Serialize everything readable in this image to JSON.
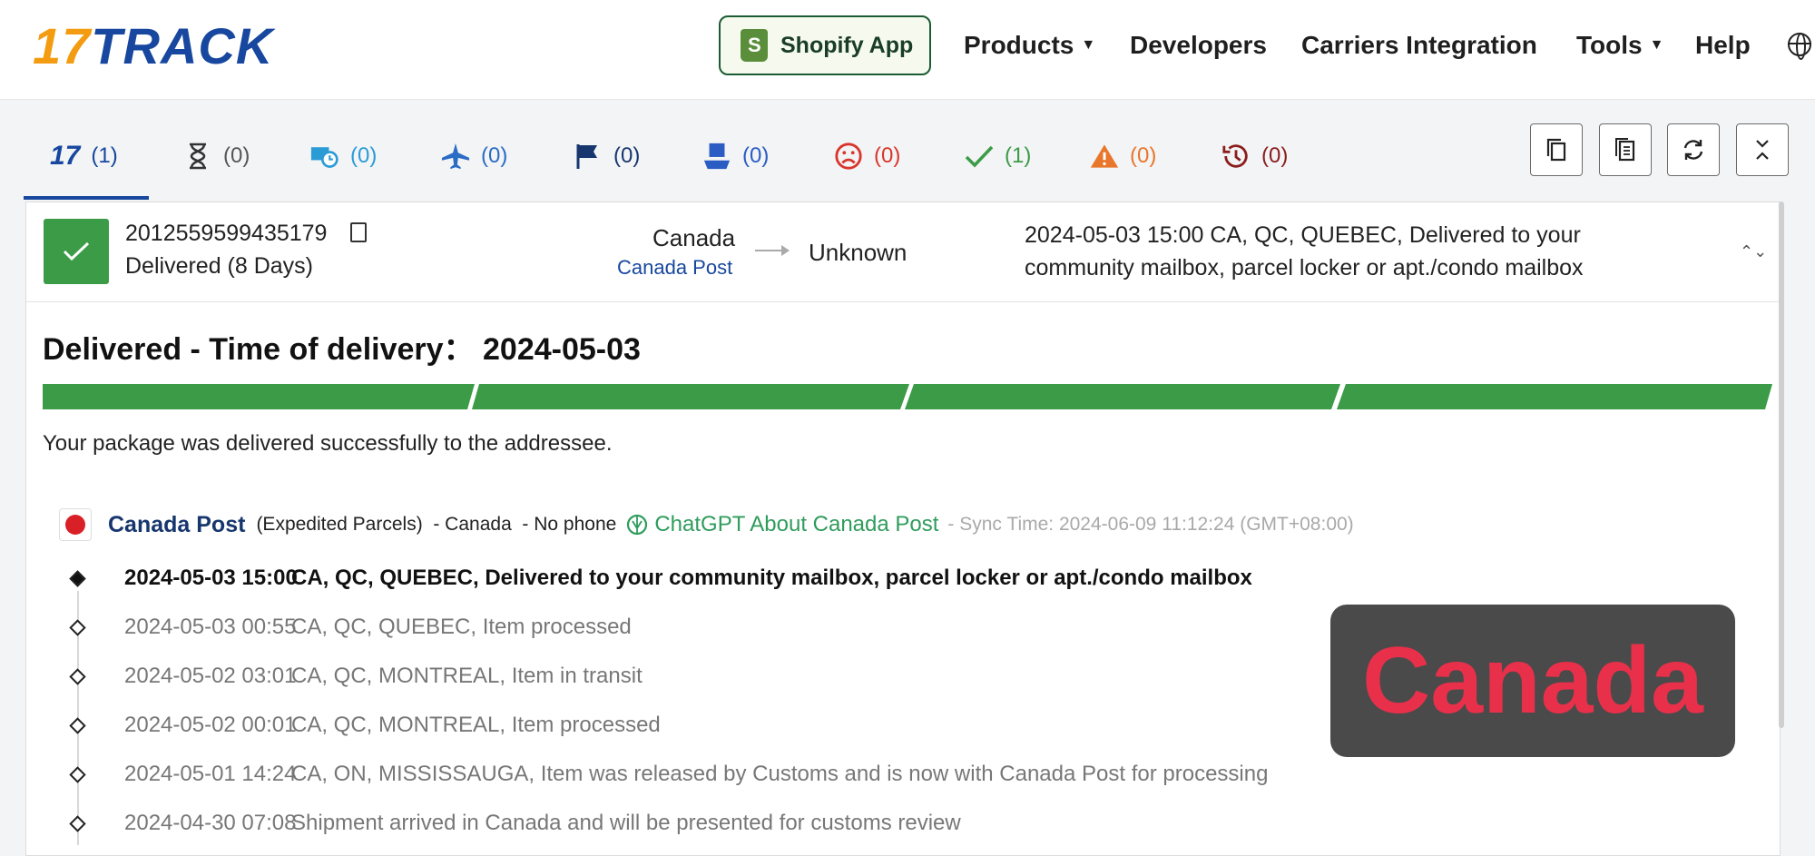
{
  "header": {
    "logo_17": "17",
    "logo_track": "TRACK",
    "shopify_label": "Shopify App",
    "nav": [
      {
        "label": "Products",
        "caret": true
      },
      {
        "label": "Developers",
        "caret": false
      },
      {
        "label": "Carriers Integration",
        "caret": false
      },
      {
        "label": "Tools",
        "caret": true
      },
      {
        "label": "Help",
        "caret": false
      }
    ]
  },
  "tabs": [
    {
      "icon": "17-logo-icon",
      "count": "(1)",
      "color": "#17479e"
    },
    {
      "icon": "hourglass-icon",
      "count": "(0)",
      "color": "#555555"
    },
    {
      "icon": "truck-clock-icon",
      "count": "(0)",
      "color": "#2b9bd6"
    },
    {
      "icon": "airplane-icon",
      "count": "(0)",
      "color": "#2b6cc4"
    },
    {
      "icon": "flag-icon",
      "count": "(0)",
      "color": "#17366e"
    },
    {
      "icon": "pickup-icon",
      "count": "(0)",
      "color": "#2b5cc4"
    },
    {
      "icon": "sad-face-icon",
      "count": "(0)",
      "color": "#d9362b"
    },
    {
      "icon": "check-icon",
      "count": "(1)",
      "color": "#3b9b46"
    },
    {
      "icon": "warning-icon",
      "count": "(0)",
      "color": "#e8762b"
    },
    {
      "icon": "history-icon",
      "count": "(0)",
      "color": "#8b1c1c"
    }
  ],
  "summary": {
    "tracking_number": "2012559599435179",
    "status": "Delivered (8 Days)",
    "origin_country": "Canada",
    "origin_carrier": "Canada Post",
    "destination": "Unknown",
    "latest_event": "2024-05-03 15:00  CA, QC, QUEBEC, Delivered to your community mailbox, parcel locker or apt./condo mailbox"
  },
  "delivery": {
    "title": "Delivered - Time of delivery：  2024-05-03",
    "progress_steps_completed": 4,
    "progress_steps_total": 4,
    "message": "Your package was delivered successfully to the addressee."
  },
  "carrier": {
    "name": "Canada Post",
    "service": "(Expedited Parcels)",
    "country": "- Canada",
    "phone": "- No phone",
    "chatgpt_label": "ChatGPT About Canada Post",
    "sync_time": "- Sync Time: 2024-06-09 11:12:24 (GMT+08:00)"
  },
  "events": [
    {
      "time": "2024-05-03 15:00",
      "desc": "CA, QC, QUEBEC, Delivered to your community mailbox, parcel locker or apt./condo mailbox"
    },
    {
      "time": "2024-05-03 00:55",
      "desc": "CA, QC, QUEBEC, Item processed"
    },
    {
      "time": "2024-05-02 03:01",
      "desc": "CA, QC, MONTREAL, Item in transit"
    },
    {
      "time": "2024-05-02 00:01",
      "desc": "CA, QC, MONTREAL, Item processed"
    },
    {
      "time": "2024-05-01 14:24",
      "desc": "CA, ON, MISSISSAUGA, Item was released by Customs and is now with Canada Post for processing"
    },
    {
      "time": "2024-04-30 07:08",
      "desc": "Shipment arrived in Canada and will be presented for customs review"
    }
  ],
  "overlay_text": "Canada"
}
